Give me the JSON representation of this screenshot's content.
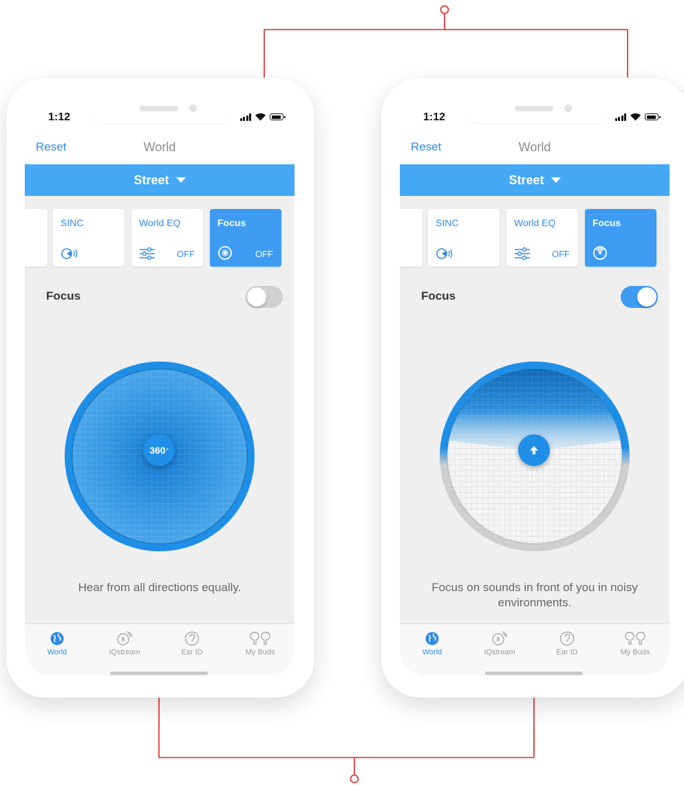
{
  "screens": [
    {
      "status": {
        "time": "1:12"
      },
      "nav": {
        "reset_label": "Reset",
        "title": "World"
      },
      "preset": {
        "label": "Street"
      },
      "cards": {
        "sinc": {
          "title": "SINC"
        },
        "world_eq": {
          "title": "World EQ",
          "status": "OFF"
        },
        "focus": {
          "title": "Focus",
          "status": "OFF"
        }
      },
      "focus_row": {
        "label": "Focus",
        "toggle_on": false
      },
      "dial": {
        "center_label": "360",
        "center_sup": "°"
      },
      "caption": "Hear from all directions equally.",
      "tabs": [
        {
          "label": "World",
          "icon": "globe-icon",
          "active": true
        },
        {
          "label": "IQstream",
          "icon": "iqstream-icon",
          "active": false
        },
        {
          "label": "Ear ID",
          "icon": "ear-id-icon",
          "active": false
        },
        {
          "label": "My Buds",
          "icon": "buds-icon",
          "active": false
        }
      ]
    },
    {
      "status": {
        "time": "1:12"
      },
      "nav": {
        "reset_label": "Reset",
        "title": "World"
      },
      "preset": {
        "label": "Street"
      },
      "cards": {
        "sinc": {
          "title": "SINC"
        },
        "world_eq": {
          "title": "World EQ",
          "status": "OFF"
        },
        "focus": {
          "title": "Focus",
          "status": ""
        }
      },
      "focus_row": {
        "label": "Focus",
        "toggle_on": true
      },
      "dial": {
        "center_label": "",
        "center_icon": "arrow-up-icon"
      },
      "caption": "Focus on sounds in front of you in noisy environments.",
      "tabs": [
        {
          "label": "World",
          "icon": "globe-icon",
          "active": true
        },
        {
          "label": "IQstream",
          "icon": "iqstream-icon",
          "active": false
        },
        {
          "label": "Ear ID",
          "icon": "ear-id-icon",
          "active": false
        },
        {
          "label": "My Buds",
          "icon": "buds-icon",
          "active": false
        }
      ]
    }
  ],
  "colors": {
    "accent": "#2f8ae8",
    "preset_bar": "#45a8f5",
    "active_card": "#3d9cf2",
    "annotation": "#e02020"
  }
}
